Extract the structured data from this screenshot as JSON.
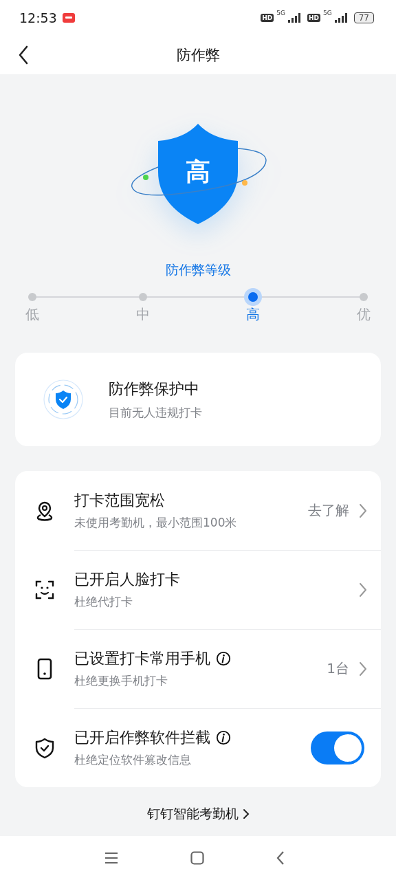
{
  "status_bar": {
    "time": "12:53",
    "sims": [
      {
        "hd": "HD",
        "network": "5G"
      },
      {
        "hd": "HD",
        "network": "5G"
      }
    ],
    "battery": "77"
  },
  "header": {
    "title": "防作弊"
  },
  "shield": {
    "label": "高"
  },
  "level": {
    "title": "防作弊等级",
    "steps": [
      {
        "label": "低",
        "selected": false
      },
      {
        "label": "中",
        "selected": false
      },
      {
        "label": "高",
        "selected": true
      },
      {
        "label": "优",
        "selected": false
      }
    ]
  },
  "protection": {
    "title": "防作弊保护中",
    "subtitle": "目前无人违规打卡"
  },
  "items": [
    {
      "kind": "link",
      "title": "打卡范围宽松",
      "subtitle": "未使用考勤机，最小范围100米",
      "value": "去了解",
      "info": false
    },
    {
      "kind": "link",
      "title": "已开启人脸打卡",
      "subtitle": "杜绝代打卡",
      "info": false
    },
    {
      "kind": "link",
      "title": "已设置打卡常用手机",
      "subtitle": "杜绝更换手机打卡",
      "value": "1台",
      "info": true
    },
    {
      "kind": "toggle",
      "title": "已开启作弊软件拦截",
      "subtitle": "杜绝定位软件篡改信息",
      "info": true,
      "on": true
    }
  ],
  "footer_link": "钉钉智能考勤机"
}
